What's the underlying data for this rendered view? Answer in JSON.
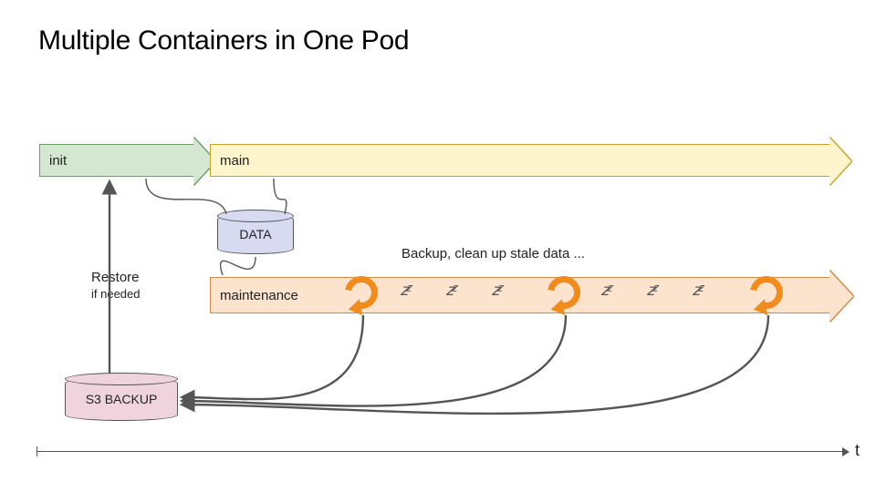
{
  "title": "Multiple Containers in One Pod",
  "bars": {
    "init": {
      "label": "init"
    },
    "main": {
      "label": "main"
    },
    "maint": {
      "label": "maintenance"
    }
  },
  "cylinders": {
    "data": {
      "label": "DATA"
    },
    "s3": {
      "label": "S3 BACKUP"
    }
  },
  "notes": {
    "restore_line1": "Restore",
    "restore_line2": "if needed",
    "backup": "Backup, clean up stale data ..."
  },
  "axis": {
    "label": "t"
  },
  "cycles_x": [
    378,
    600,
    822
  ],
  "sleep_x": [
    440,
    490,
    540,
    660,
    710,
    760
  ],
  "sleep_glyph": "zᶻ",
  "colors": {
    "init_fill": "#d4e8d1",
    "main_fill": "#fff5cc",
    "maint_fill": "#fce3ce",
    "data_fill": "#d7daf1",
    "s3_fill": "#efd4de",
    "cycle": "#f18c1c",
    "stroke": "#555555"
  }
}
